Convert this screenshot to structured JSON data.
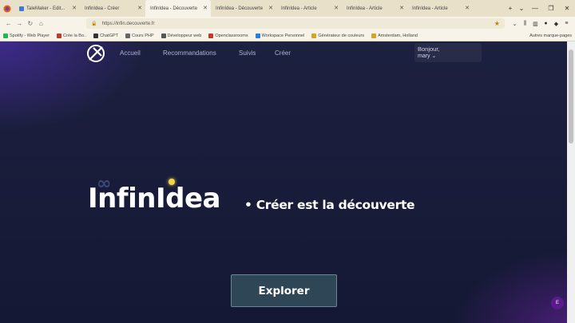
{
  "browser": {
    "tabs": [
      {
        "label": "TaleMaker - Edit...",
        "color": "#3a7bd5"
      },
      {
        "label": "InfinIdea - Créer",
        "color": "#7a7a7a"
      },
      {
        "label": "InfinIdea - Découverte",
        "color": "#7a7a7a",
        "active": true
      },
      {
        "label": "InfinIdea - Découverte",
        "color": "#7a7a7a"
      },
      {
        "label": "InfinIdea - Article",
        "color": "#7a7a7a"
      },
      {
        "label": "InfinIdea - Article",
        "color": "#7a7a7a"
      },
      {
        "label": "InfinIdea - Article",
        "color": "#7a7a7a"
      }
    ],
    "url": "https://infin.decouverte.fr",
    "bookmarks": [
      {
        "label": "Spotify - Web Player",
        "color": "#1db954"
      },
      {
        "label": "Crée la Bo..",
        "color": "#c0392b"
      },
      {
        "label": "ChatGPT",
        "color": "#333333"
      },
      {
        "label": "Cours PHP",
        "color": "#666666"
      },
      {
        "label": "Développeur web",
        "color": "#555555"
      },
      {
        "label": "Openclassrooms",
        "color": "#c0392b"
      },
      {
        "label": "Workspace Personnel",
        "color": "#2a7fd4"
      },
      {
        "label": "Générateur de couleurs",
        "color": "#d4a42a"
      },
      {
        "label": "Amsterdam, Holland",
        "color": "#d4a42a"
      }
    ],
    "bookmarks_other": "Autres marque-pages"
  },
  "site": {
    "menu": [
      "Accueil",
      "Recommandations",
      "Suivis",
      "Créer"
    ],
    "greeting": "Bonjour,",
    "username": "mary ⌄",
    "brand": "InfinIdea",
    "brand_mark": "∞",
    "tagline": "• Créer est la découverte",
    "explore_label": "Explorer",
    "fab_label": "E"
  },
  "colors": {
    "page_bg": "#141834",
    "accent_purple": "#3f2a8c",
    "button_bg": "#2e4656",
    "bulb": "#f5d44a"
  }
}
